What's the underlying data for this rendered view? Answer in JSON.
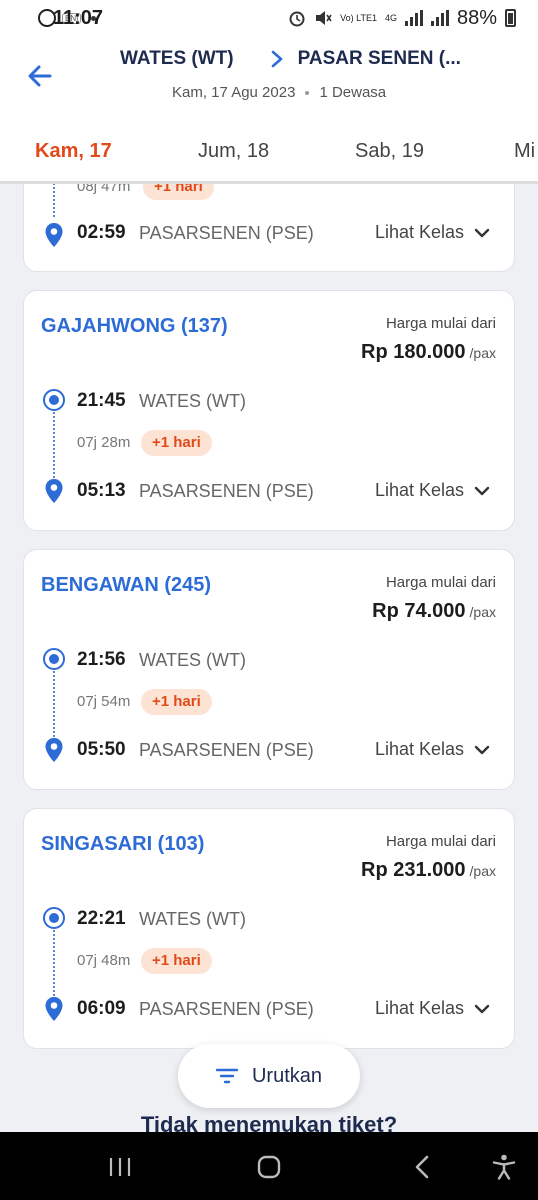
{
  "status_bar": {
    "time": "11:07",
    "bni_label": "BNI",
    "network": "Vo) LTE1",
    "network_type": "4G",
    "battery": "88%"
  },
  "header": {
    "origin": "WATES (WT)",
    "destination": "PASAR SENEN (...",
    "date": "Kam, 17 Agu 2023",
    "passengers": "1 Dewasa"
  },
  "tabs": [
    {
      "label": "Kam, 17",
      "active": true
    },
    {
      "label": "Jum, 18",
      "active": false
    },
    {
      "label": "Sab, 19",
      "active": false
    },
    {
      "label": "Mi",
      "active": false
    }
  ],
  "partial_card": {
    "duration": "08j 47m",
    "badge": "+1 hari",
    "arrival_time": "02:59",
    "arrival_station": "PASARSENEN (PSE)",
    "action": "Lihat Kelas"
  },
  "cards": [
    {
      "train": "GAJAHWONG (137)",
      "price_label": "Harga mulai dari",
      "price": "Rp 180.000",
      "per": "/pax",
      "departure_time": "21:45",
      "departure_station": "WATES (WT)",
      "duration": "07j 28m",
      "badge": "+1 hari",
      "arrival_time": "05:13",
      "arrival_station": "PASARSENEN (PSE)",
      "action": "Lihat Kelas"
    },
    {
      "train": "BENGAWAN (245)",
      "price_label": "Harga mulai dari",
      "price": "Rp 74.000",
      "per": "/pax",
      "departure_time": "21:56",
      "departure_station": "WATES (WT)",
      "duration": "07j 54m",
      "badge": "+1 hari",
      "arrival_time": "05:50",
      "arrival_station": "PASARSENEN (PSE)",
      "action": "Lihat Kelas"
    },
    {
      "train": "SINGASARI (103)",
      "price_label": "Harga mulai dari",
      "price": "Rp 231.000",
      "per": "/pax",
      "departure_time": "22:21",
      "departure_station": "WATES (WT)",
      "duration": "07j 48m",
      "badge": "+1 hari",
      "arrival_time": "06:09",
      "arrival_station": "PASARSENEN (PSE)",
      "action": "Lihat Kelas"
    }
  ],
  "sort_button": {
    "label": "Urutkan"
  },
  "footer": {
    "text": "Tidak menemukan tiket?"
  },
  "colors": {
    "accent": "#e2491b",
    "primary": "#2d6bd6",
    "badge_bg": "#fde3d4"
  }
}
